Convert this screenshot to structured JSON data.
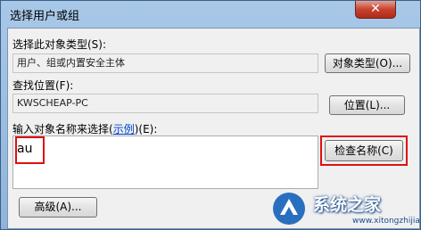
{
  "window": {
    "title": "选择用户或组",
    "close_glyph": "✕"
  },
  "object_type": {
    "label": "选择此对象类型(S):",
    "value": "用户、组或内置安全主体",
    "button": "对象类型(O)..."
  },
  "location": {
    "label": "查找位置(F):",
    "value": "KWSCHEAP-PC",
    "button": "位置(L)..."
  },
  "names": {
    "label_before": "输入对象名称来选择(",
    "examples_link": "示例",
    "label_after": ")(E):",
    "value": "au",
    "check_button": "检查名称(C)"
  },
  "footer": {
    "advanced_button": "高级(A)..."
  },
  "watermark": {
    "brand": "系统之家",
    "url": "www.xitongzhijia.net"
  },
  "colors": {
    "highlight": "#e01010",
    "link": "#0044cc"
  }
}
